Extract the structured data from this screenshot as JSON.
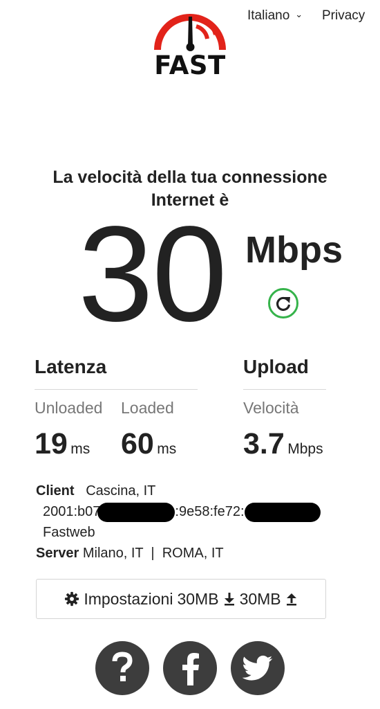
{
  "logo": {
    "wordmark": "FAST",
    "accent_color": "#e2231a"
  },
  "header": {
    "language": "Italiano",
    "privacy": "Privacy"
  },
  "speed": {
    "headline": "La velocità della tua connessione Internet è",
    "value": "30",
    "unit": "Mbps",
    "refresh_icon": "refresh-icon",
    "accent_color": "#35b34a"
  },
  "latency": {
    "title": "Latenza",
    "unloaded_label": "Unloaded",
    "loaded_label": "Loaded",
    "unloaded_value": "19",
    "loaded_value": "60",
    "unit": "ms"
  },
  "upload": {
    "title": "Upload",
    "label": "Velocità",
    "value": "3.7",
    "unit": "Mbps"
  },
  "client": {
    "label": "Client",
    "location": "Cascina, IT",
    "ip_prefix": "2001:b07",
    "ip_middle": ":9e58:fe72:",
    "isp": "Fastweb"
  },
  "server": {
    "label": "Server",
    "locations": "Milano, IT  |  ROMA, IT"
  },
  "settings": {
    "label": "Impostazioni",
    "download_size": "30MB",
    "upload_size": "30MB"
  },
  "social": [
    "help-icon",
    "facebook-icon",
    "twitter-icon"
  ]
}
